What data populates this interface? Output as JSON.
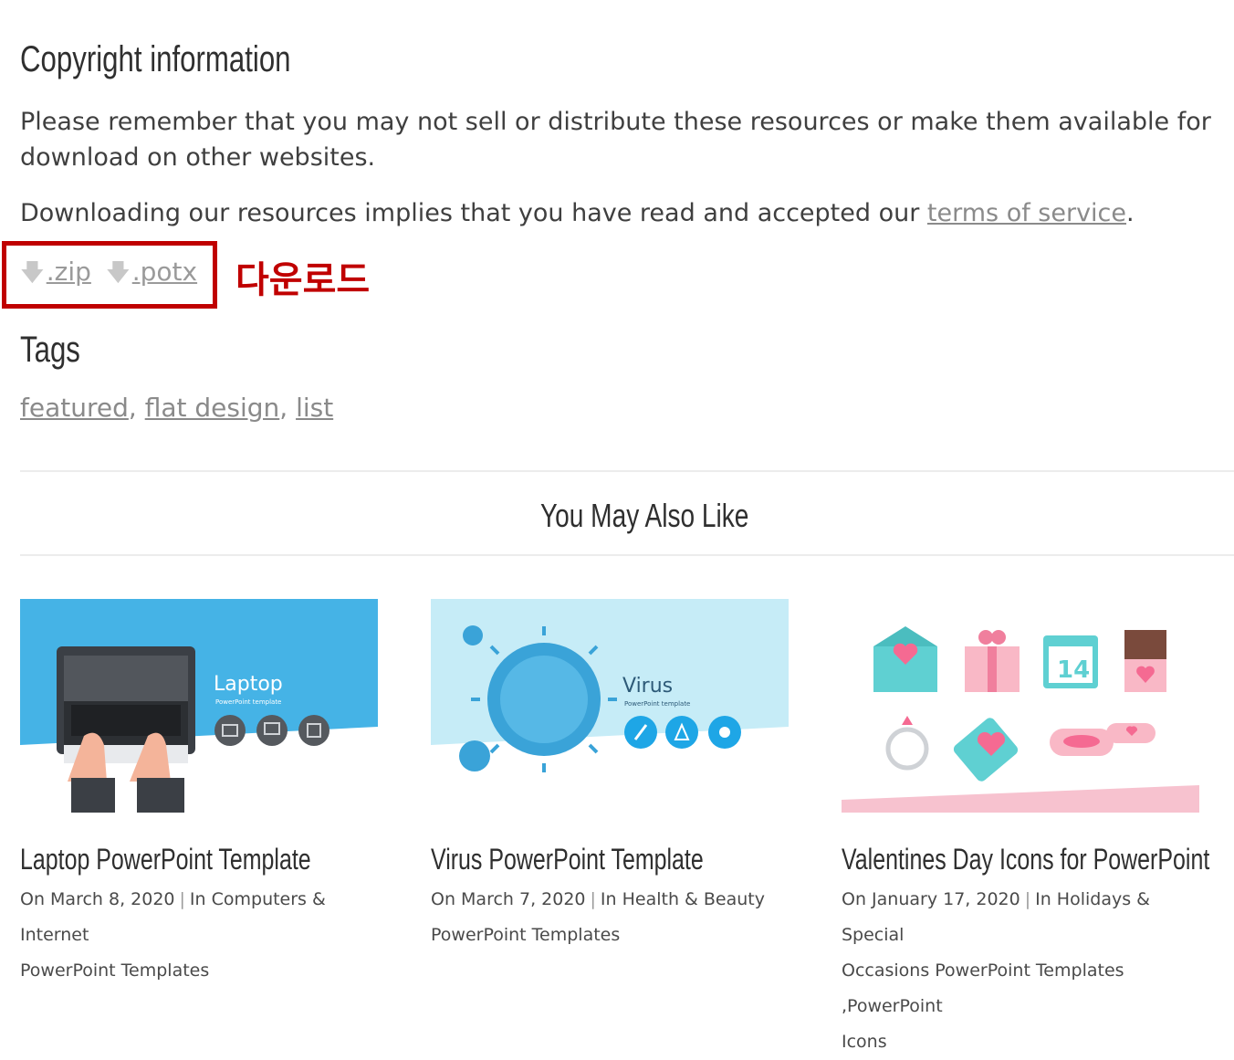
{
  "copyright": {
    "heading": "Copyright information",
    "para1": "Please remember that you may not sell or distribute these resources or make them available for download on other websites.",
    "para2_prefix": "Downloading our resources implies that you have read and accepted our ",
    "para2_link": "terms of service",
    "para2_suffix": "."
  },
  "downloads": {
    "zip_label": ".zip",
    "potx_label": ".potx",
    "annotation": "다운로드",
    "highlight_color": "#c00000"
  },
  "tags": {
    "heading": "Tags",
    "items": [
      "featured",
      "flat design",
      "list"
    ],
    "separator": ", "
  },
  "related": {
    "heading": "You May Also Like",
    "cards": [
      {
        "title": "Laptop PowerPoint Template",
        "date": "On March 8, 2020",
        "category_line1": "In Computers & Internet",
        "category_line2": "PowerPoint Templates",
        "category_line3": "",
        "thumb_title": "Laptop",
        "thumb_sub": "PowerPoint template"
      },
      {
        "title": "Virus PowerPoint Template",
        "date": "On March 7, 2020",
        "category_line1": "In Health & Beauty",
        "category_line2": "PowerPoint Templates",
        "category_line3": "",
        "thumb_title": "Virus",
        "thumb_sub": "PowerPoint template"
      },
      {
        "title": "Valentines Day Icons for PowerPoint",
        "date": "On January 17, 2020",
        "category_line1": "In Holidays & Special",
        "category_line2": "Occasions PowerPoint Templates ,PowerPoint",
        "category_line3": "Icons",
        "thumb_calendar": "14"
      }
    ]
  }
}
